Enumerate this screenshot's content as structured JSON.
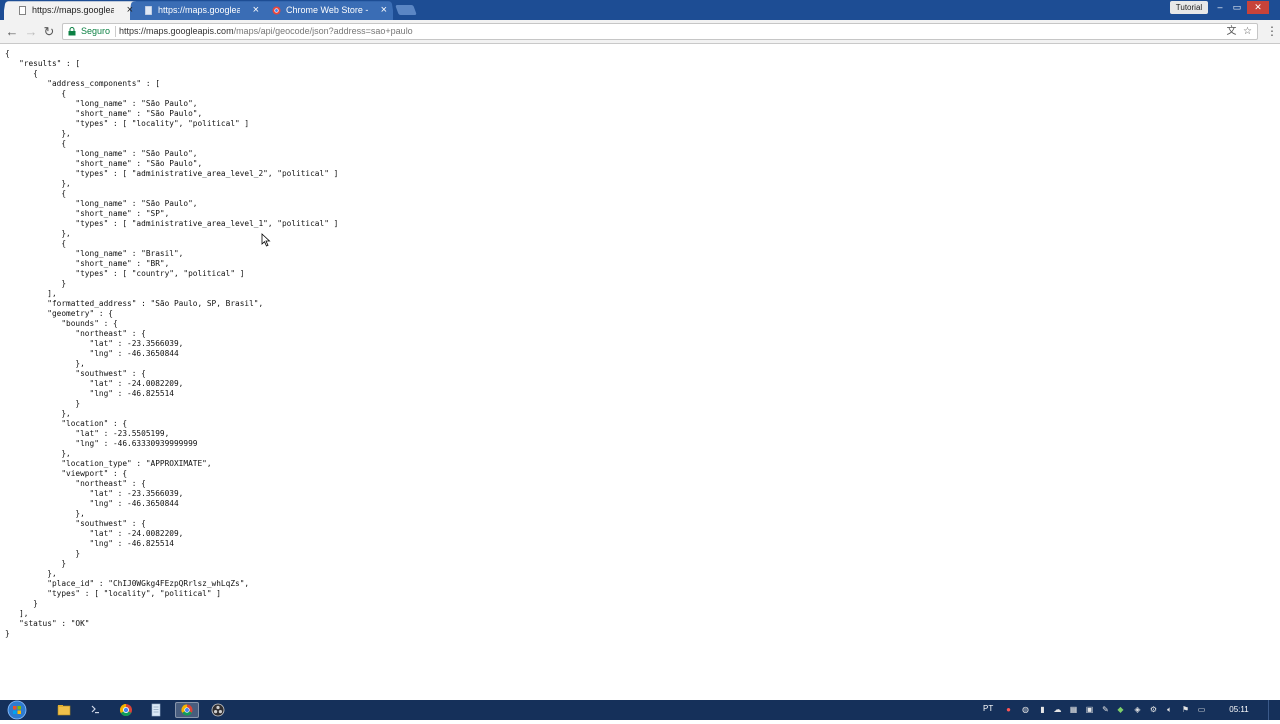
{
  "browser": {
    "tabs": [
      {
        "label": "https://maps.googleapis",
        "active": true,
        "icon": "page-icon"
      },
      {
        "label": "https://maps.googleapis",
        "active": false,
        "icon": "page-icon"
      },
      {
        "label": "Chrome Web Store - json",
        "active": false,
        "icon": "chrome-store-icon"
      }
    ],
    "user_badge": "Tutorial",
    "window_controls": {
      "minimize": "–",
      "maximize": "▭",
      "close": "✕"
    },
    "security_label": "Seguro",
    "url_host": "https://maps.googleapis.com",
    "url_path": "/maps/api/geocode/json?address=sao+paulo"
  },
  "json_text": "{\n   \"results\" : [\n      {\n         \"address_components\" : [\n            {\n               \"long_name\" : \"São Paulo\",\n               \"short_name\" : \"São Paulo\",\n               \"types\" : [ \"locality\", \"political\" ]\n            },\n            {\n               \"long_name\" : \"São Paulo\",\n               \"short_name\" : \"São Paulo\",\n               \"types\" : [ \"administrative_area_level_2\", \"political\" ]\n            },\n            {\n               \"long_name\" : \"São Paulo\",\n               \"short_name\" : \"SP\",\n               \"types\" : [ \"administrative_area_level_1\", \"political\" ]\n            },\n            {\n               \"long_name\" : \"Brasil\",\n               \"short_name\" : \"BR\",\n               \"types\" : [ \"country\", \"political\" ]\n            }\n         ],\n         \"formatted_address\" : \"São Paulo, SP, Brasil\",\n         \"geometry\" : {\n            \"bounds\" : {\n               \"northeast\" : {\n                  \"lat\" : -23.3566039,\n                  \"lng\" : -46.3650844\n               },\n               \"southwest\" : {\n                  \"lat\" : -24.0082209,\n                  \"lng\" : -46.825514\n               }\n            },\n            \"location\" : {\n               \"lat\" : -23.5505199,\n               \"lng\" : -46.63330939999999\n            },\n            \"location_type\" : \"APPROXIMATE\",\n            \"viewport\" : {\n               \"northeast\" : {\n                  \"lat\" : -23.3566039,\n                  \"lng\" : -46.3650844\n               },\n               \"southwest\" : {\n                  \"lat\" : -24.0082209,\n                  \"lng\" : -46.825514\n               }\n            }\n         },\n         \"place_id\" : \"ChIJ0WGkg4FEzpQRrlsz_whLqZs\",\n         \"types\" : [ \"locality\", \"political\" ]\n      }\n   ],\n   \"status\" : \"OK\"\n}",
  "taskbar": {
    "language": "PT",
    "clock": "05:11",
    "apps": [
      "windows-explorer-icon",
      "cmd-icon",
      "chrome-icon",
      "notepad-icon",
      "chrome-active-icon",
      "obs-icon"
    ]
  },
  "colors": {
    "titlebar": "#1d4d94",
    "taskbar": "#15305a",
    "secure": "#0b8043"
  }
}
